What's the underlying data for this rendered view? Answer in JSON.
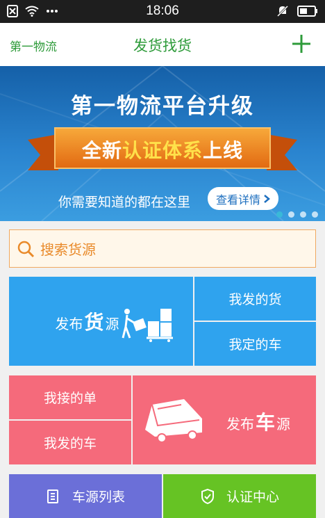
{
  "status_bar": {
    "time": "18:06"
  },
  "nav": {
    "left_label": "第一物流",
    "title": "发货找货"
  },
  "banner": {
    "title": "第一物流平台升级",
    "ribbon_part1": "全新",
    "ribbon_highlight": "认证体系",
    "ribbon_part2": "上线",
    "subtitle": "你需要知道的都在这里",
    "details_label": "查看详情",
    "slide_count": 4,
    "active_slide": 1
  },
  "search": {
    "placeholder": "搜索货源"
  },
  "tiles": {
    "publish_cargo": {
      "prefix": "发布",
      "big": "货",
      "suffix": "源"
    },
    "my_sent_cargo": "我发的货",
    "my_booked_truck": "我定的车",
    "my_received_order": "我接的单",
    "my_sent_truck": "我发的车",
    "publish_truck": {
      "prefix": "发布",
      "big": "车",
      "suffix": "源"
    },
    "truck_list": "车源列表",
    "cert_center": "认证中心"
  },
  "colors": {
    "brand_green": "#2e9b3a",
    "tile_blue": "#2fa3ee",
    "tile_pink": "#f56a7b",
    "tile_purple": "#6b6fd8",
    "tile_green": "#66c324",
    "search_orange": "#e98a2a"
  }
}
